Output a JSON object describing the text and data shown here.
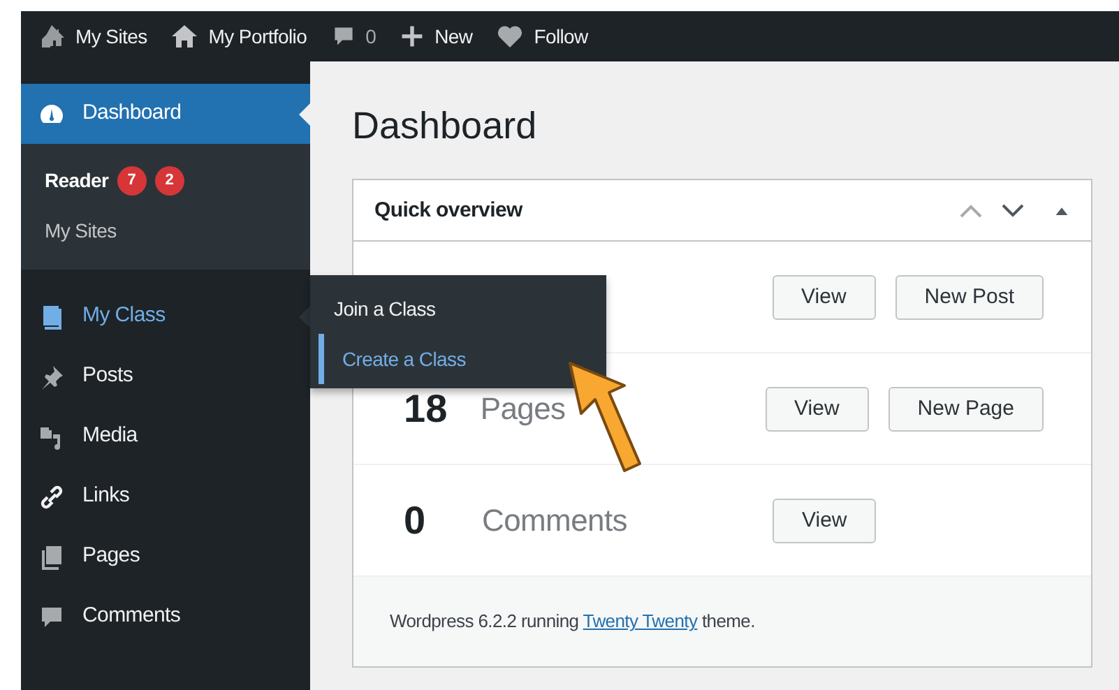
{
  "admin_bar": [
    {
      "label": "My Sites"
    },
    {
      "label": "My Portfolio"
    },
    {
      "label": "0"
    },
    {
      "label": "New"
    },
    {
      "label": "Follow"
    }
  ],
  "sidebar": {
    "items": [
      {
        "label": "Dashboard",
        "selected": true,
        "open": false,
        "children": [
          {
            "label": "Reader",
            "badges": [
              "7",
              "2"
            ]
          },
          {
            "label": "My Sites"
          }
        ]
      },
      {
        "label": "My Class",
        "selected": false,
        "open": true,
        "flyout": [
          {
            "label": "Join a Class",
            "selected": false
          },
          {
            "label": "Create a Class",
            "selected": true
          }
        ]
      },
      {
        "label": "Posts",
        "selected": false,
        "open": false
      },
      {
        "label": "Media",
        "selected": false,
        "open": false
      },
      {
        "label": "Links",
        "selected": false,
        "open": false
      },
      {
        "label": "Pages",
        "selected": false,
        "open": false
      },
      {
        "label": "Comments",
        "selected": false,
        "open": false
      }
    ]
  },
  "page_title": "Dashboard",
  "overview": {
    "title": "Quick overview",
    "rows": [
      {
        "buttons": [
          "View",
          "New Post"
        ]
      },
      {
        "count": "18",
        "label": "Pages",
        "buttons": [
          "View",
          "New Page"
        ]
      },
      {
        "count": "0",
        "label": "Comments",
        "buttons": [
          "View"
        ]
      }
    ],
    "footer": {
      "before": "Wordpress 6.2.2 running",
      "link": "Twenty Twenty",
      "after": "theme."
    }
  }
}
